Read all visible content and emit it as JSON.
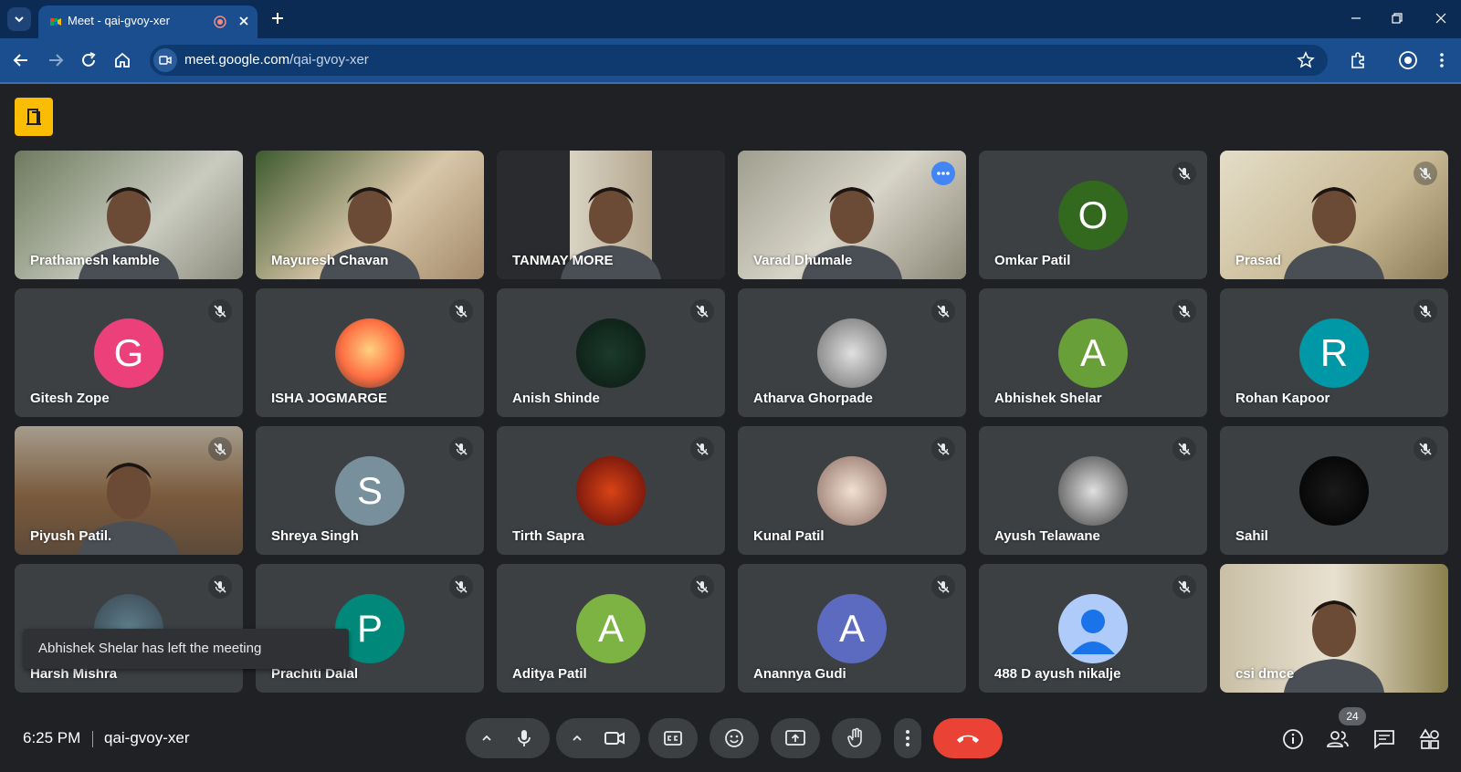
{
  "browser": {
    "tab_title": "Meet - qai-gvoy-xer",
    "url_host": "meet.google.com",
    "url_path": "/qai-gvoy-xer"
  },
  "participants": [
    {
      "name": "Prathamesh kamble",
      "type": "video",
      "muted": false
    },
    {
      "name": "Mayuresh Chavan",
      "type": "video",
      "muted": false
    },
    {
      "name": "TANMAY MORE",
      "type": "video",
      "muted": false
    },
    {
      "name": "Varad Dhumale",
      "type": "video",
      "muted": false,
      "active": true
    },
    {
      "name": "Omkar Patil",
      "type": "letter",
      "letter": "O",
      "color": "#33691e",
      "muted": true
    },
    {
      "name": "Prasad",
      "type": "video",
      "muted": true
    },
    {
      "name": "Gitesh Zope",
      "type": "letter",
      "letter": "G",
      "color": "#ec407a",
      "muted": true
    },
    {
      "name": "ISHA JOGMARGE",
      "type": "photo",
      "muted": true
    },
    {
      "name": "Anish Shinde",
      "type": "photo",
      "muted": true
    },
    {
      "name": "Atharva Ghorpade",
      "type": "photo",
      "muted": true
    },
    {
      "name": "Abhishek Shelar",
      "type": "letter",
      "letter": "A",
      "color": "#689f38",
      "muted": true
    },
    {
      "name": "Rohan Kapoor",
      "type": "letter",
      "letter": "R",
      "color": "#0097a7",
      "muted": true
    },
    {
      "name": "Piyush Patil.",
      "type": "video",
      "muted": true
    },
    {
      "name": "Shreya Singh",
      "type": "letter",
      "letter": "S",
      "color": "#78909c",
      "muted": true
    },
    {
      "name": "Tirth Sapra",
      "type": "photo",
      "muted": true
    },
    {
      "name": "Kunal Patil",
      "type": "photo",
      "muted": true
    },
    {
      "name": "Ayush Telawane",
      "type": "photo",
      "muted": true
    },
    {
      "name": "Sahil",
      "type": "photo",
      "muted": true
    },
    {
      "name": "Harsh Mishra",
      "type": "photo",
      "muted": true
    },
    {
      "name": "Prachiti Dalal",
      "type": "letter",
      "letter": "P",
      "color": "#00897b",
      "muted": true
    },
    {
      "name": "Aditya Patil",
      "type": "letter",
      "letter": "A",
      "color": "#7cb342",
      "muted": true
    },
    {
      "name": "Anannya Gudi",
      "type": "letter",
      "letter": "A",
      "color": "#5c6bc0",
      "muted": true
    },
    {
      "name": "488 D ayush nikalje",
      "type": "default",
      "muted": true
    },
    {
      "name": "csi dmce",
      "type": "video",
      "muted": false
    }
  ],
  "toast": "Abhishek Shelar has left the meeting",
  "bottom_bar": {
    "time": "6:25 PM",
    "meeting_code": "qai-gvoy-xer",
    "people_count": "24"
  },
  "icons": {
    "tab_list": "chevron-down-icon",
    "rec": "recording-icon",
    "mic": "microphone-icon",
    "camera": "camera-icon",
    "captions": "captions-icon",
    "reactions": "emoji-icon",
    "present": "present-screen-icon",
    "hand": "raise-hand-icon",
    "more": "more-vert-icon",
    "leave": "hang-up-icon",
    "info": "info-icon",
    "people": "people-icon",
    "chat": "chat-icon",
    "activities": "activities-icon"
  },
  "colors": {
    "accent_blue": "#8ab4f8",
    "leave_red": "#ea4335",
    "tile_bg": "#3c4043",
    "page_bg": "#202124"
  }
}
